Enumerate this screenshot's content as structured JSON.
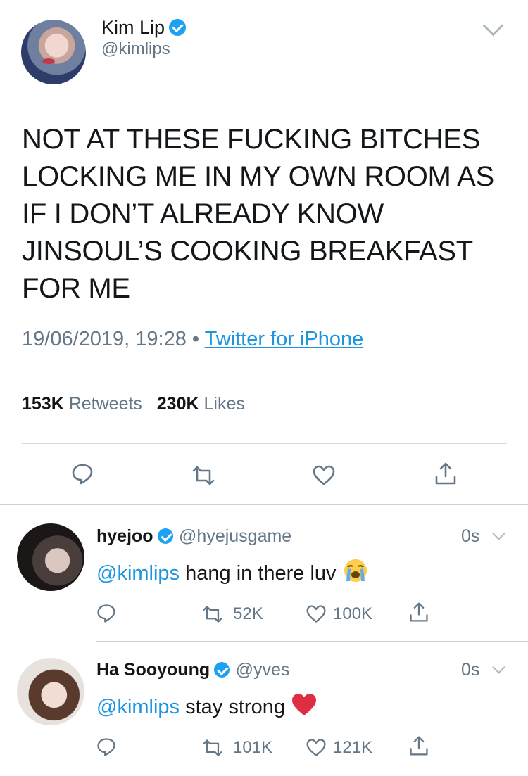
{
  "main_tweet": {
    "display_name": "Kim Lip",
    "handle": "@kimlips",
    "text": "NOT AT THESE FUCKING BITCHES LOCKING ME IN MY OWN ROOM AS IF I DON’T ALREADY KNOW JINSOUL’S COOKING BREAKFAST FOR ME",
    "timestamp": "19/06/2019, 19:28",
    "separator": "•",
    "source": "Twitter for iPhone",
    "retweets_count": "153K",
    "retweets_label": "Retweets",
    "likes_count": "230K",
    "likes_label": "Likes"
  },
  "replies": [
    {
      "display_name": "hyejoo",
      "handle": "@hyejusgame",
      "time": "0s",
      "mention": "@kimlips",
      "text": "hang in there luv",
      "emoji": "loudly-crying-face",
      "retweets": "52K",
      "likes": "100K"
    },
    {
      "display_name": "Ha Sooyoung",
      "handle": "@yves",
      "time": "0s",
      "mention": "@kimlips",
      "text": "stay strong",
      "emoji": "red-heart",
      "retweets": "101K",
      "likes": "121K"
    }
  ],
  "colors": {
    "link_blue": "#1b95e0",
    "verified_blue": "#1da1f2",
    "secondary_text": "#657786",
    "icon_gray": "#657786"
  }
}
